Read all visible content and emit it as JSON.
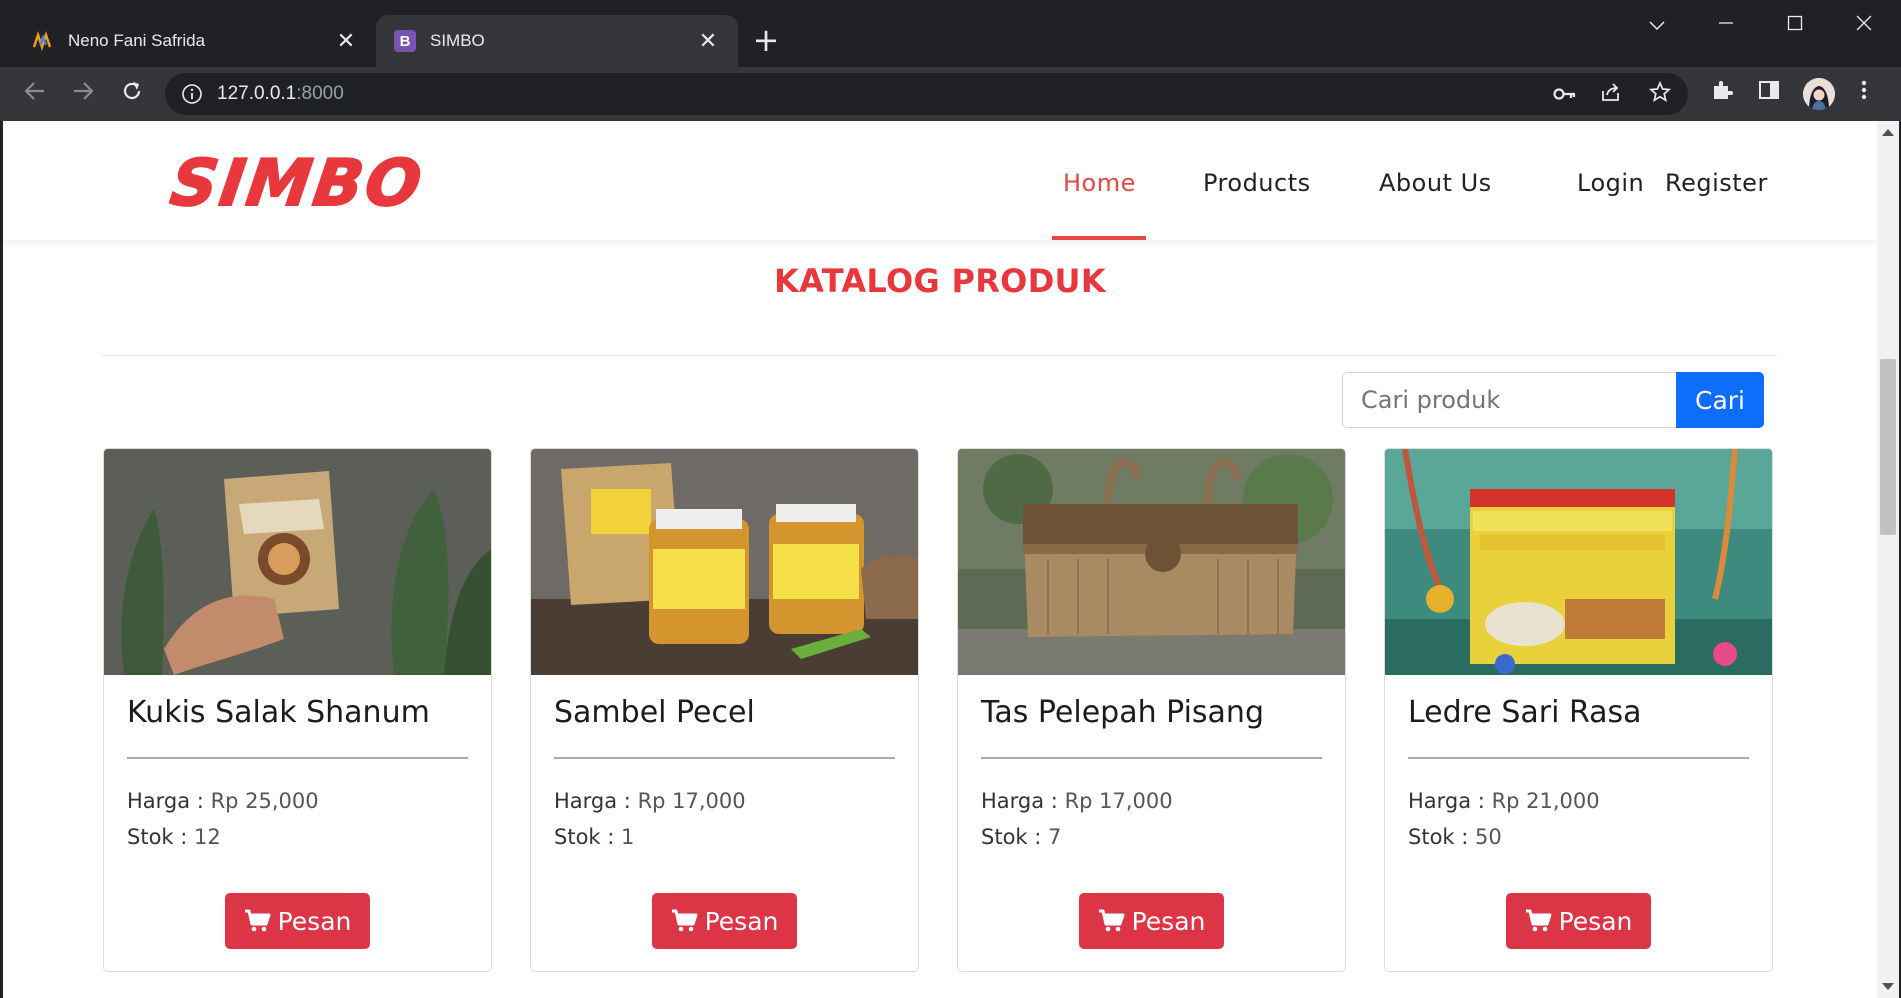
{
  "browser": {
    "tabs": [
      {
        "title": "Neno Fani Safrida",
        "active": false
      },
      {
        "title": "SIMBO",
        "active": true
      }
    ],
    "url_host": "127.0.0.1",
    "url_port": ":8000"
  },
  "site": {
    "logo_text": "SIMBO",
    "nav": [
      {
        "label": "Home",
        "active": true
      },
      {
        "label": "Products",
        "active": false
      },
      {
        "label": "About Us",
        "active": false
      }
    ],
    "login_label": "Login",
    "register_label": "Register",
    "accent_color": "#e84545"
  },
  "catalog": {
    "heading": "KATALOG PRODUK",
    "search_placeholder": "Cari produk",
    "search_button": "Cari",
    "price_label": "Harga :",
    "stock_label": "Stok :",
    "order_label": "Pesan",
    "products": [
      {
        "name": "Kukis Salak Shanum",
        "price": "Rp 25,000",
        "stock": "12"
      },
      {
        "name": "Sambel Pecel",
        "price": "Rp 17,000",
        "stock": "1"
      },
      {
        "name": "Tas Pelepah Pisang",
        "price": "Rp 17,000",
        "stock": "7"
      },
      {
        "name": "Ledre Sari Rasa",
        "price": "Rp 21,000",
        "stock": "50"
      }
    ]
  }
}
